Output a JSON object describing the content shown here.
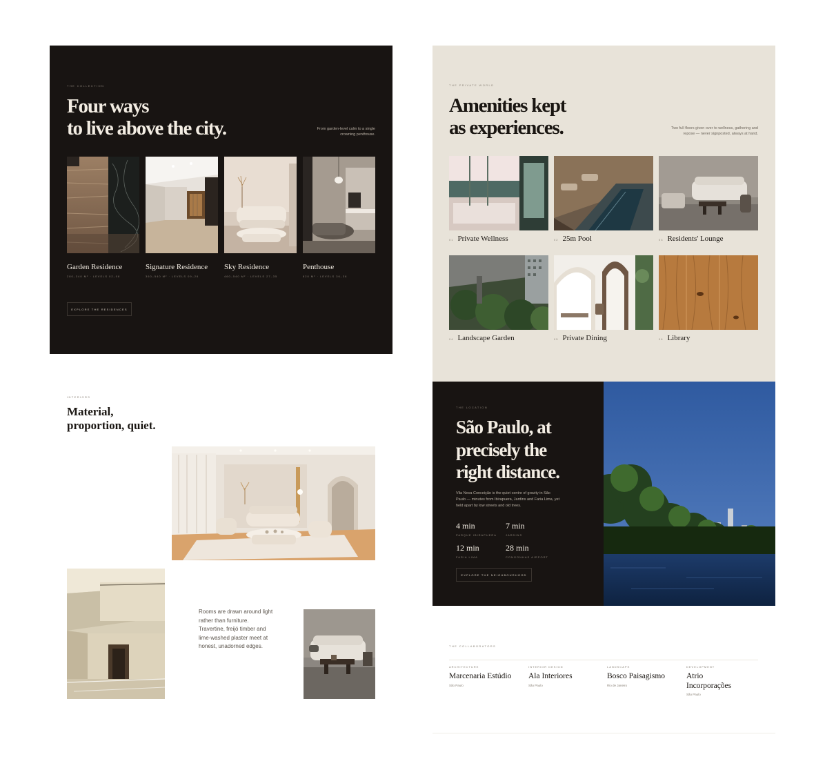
{
  "collection": {
    "eyebrow": "THE COLLECTION",
    "headline_line1": "Four ways",
    "headline_line2": "to live above the city.",
    "side_note": "From garden-level calm to a single crowning penthouse.",
    "residences": [
      {
        "name": "Garden Residence",
        "meta": "280–340 M² · LEVELS 02–08"
      },
      {
        "name": "Signature Residence",
        "meta": "360–540 M² · LEVELS 09–26"
      },
      {
        "name": "Sky Residence",
        "meta": "460–540 M² · LEVELS 27–35"
      },
      {
        "name": "Penthouse",
        "meta": "820 M² · LEVELS 36–38"
      }
    ],
    "cta": "EXPLORE THE RESIDENCES"
  },
  "interiors": {
    "eyebrow": "INTERIORS",
    "headline_line1": "Material,",
    "headline_line2": "proportion, quiet.",
    "body": "Rooms are drawn around light rather than furniture. Travertine, freijó timber and lime-washed plaster meet at honest, unadorned edges."
  },
  "amenities": {
    "eyebrow": "THE PRIVATE WORLD",
    "headline_line1": "Amenities kept",
    "headline_line2": "as experiences.",
    "side_note": "Two full floors given over to wellness, gathering and repose — never signposted, always at hand.",
    "items": [
      {
        "num": "01",
        "label": "Private Wellness"
      },
      {
        "num": "02",
        "label": "25m Pool"
      },
      {
        "num": "03",
        "label": "Residents' Lounge"
      },
      {
        "num": "04",
        "label": "Landscape Garden"
      },
      {
        "num": "05",
        "label": "Private Dining"
      },
      {
        "num": "06",
        "label": "Library"
      }
    ]
  },
  "location": {
    "eyebrow": "THE LOCATION",
    "headline_line1": "São Paulo, at",
    "headline_line2": "precisely the",
    "headline_line3": "right distance.",
    "body": "Vila Nova Conceição is the quiet centre of gravity in São Paulo — minutes from Ibirapuera, Jardins and Faria Lima, yet held apart by low streets and old trees.",
    "stats": [
      {
        "value": "4 min",
        "label": "PARQUE IBIRAPUERA"
      },
      {
        "value": "7 min",
        "label": "JARDINS"
      },
      {
        "value": "12 min",
        "label": "FARIA LIMA"
      },
      {
        "value": "28 min",
        "label": "CONGONHAS AIRPORT"
      }
    ],
    "cta": "EXPLORE THE NEIGHBOURHOOD"
  },
  "collaborators": {
    "eyebrow": "THE COLLABORATORS",
    "items": [
      {
        "role": "ARCHITECTURE",
        "firm": "Marcenaria Estúdio",
        "city": "São Paulo"
      },
      {
        "role": "INTERIOR DESIGN",
        "firm": "Ala Interiores",
        "city": "São Paulo"
      },
      {
        "role": "LANDSCAPE",
        "firm": "Bosco Paisagismo",
        "city": "Rio de Janeiro"
      },
      {
        "role": "DEVELOPMENT",
        "firm": "Atrio Incorporações",
        "city": "São Paulo"
      }
    ]
  }
}
